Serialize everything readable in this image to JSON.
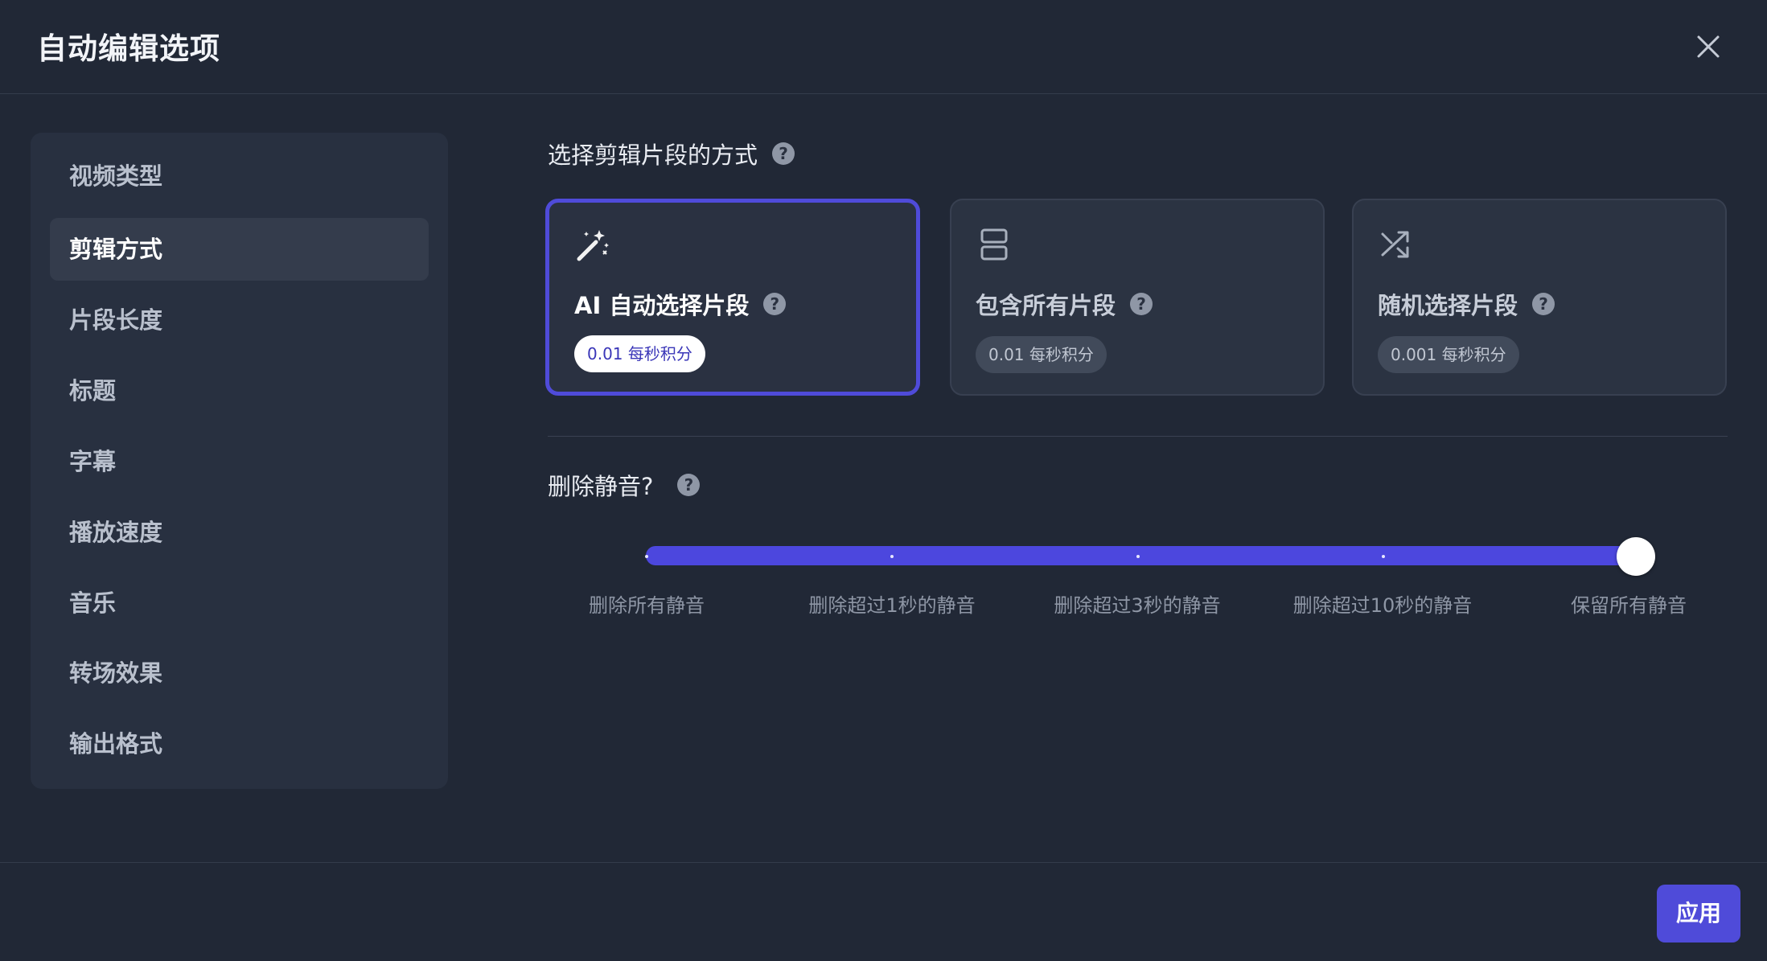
{
  "dialog": {
    "title": "自动编辑选项",
    "close_icon": "close-icon"
  },
  "sidebar": {
    "items": [
      {
        "label": "视频类型",
        "active": false
      },
      {
        "label": "剪辑方式",
        "active": true
      },
      {
        "label": "片段长度",
        "active": false
      },
      {
        "label": "标题",
        "active": false
      },
      {
        "label": "字幕",
        "active": false
      },
      {
        "label": "播放速度",
        "active": false
      },
      {
        "label": "音乐",
        "active": false
      },
      {
        "label": "转场效果",
        "active": false
      },
      {
        "label": "输出格式",
        "active": false
      }
    ]
  },
  "clip_method": {
    "heading": "选择剪辑片段的方式",
    "help_glyph": "?",
    "options": [
      {
        "label": "AI 自动选择片段",
        "badge": "0.01 每秒积分",
        "icon": "magic-wand-icon",
        "selected": true
      },
      {
        "label": "包含所有片段",
        "badge": "0.01 每秒积分",
        "icon": "layout-rows-icon",
        "selected": false
      },
      {
        "label": "随机选择片段",
        "badge": "0.001 每秒积分",
        "icon": "shuffle-icon",
        "selected": false
      }
    ]
  },
  "silence": {
    "heading": "删除静音?",
    "help_glyph": "?",
    "selected_index": 4,
    "steps": [
      "删除所有静音",
      "删除超过1秒的静音",
      "删除超过3秒的静音",
      "删除超过10秒的静音",
      "保留所有静音"
    ]
  },
  "footer": {
    "apply_label": "应用"
  },
  "colors": {
    "background": "#212836",
    "accent": "#4f4bd9",
    "sidebar_bg": "#283040",
    "card_bg": "#2b3342"
  }
}
